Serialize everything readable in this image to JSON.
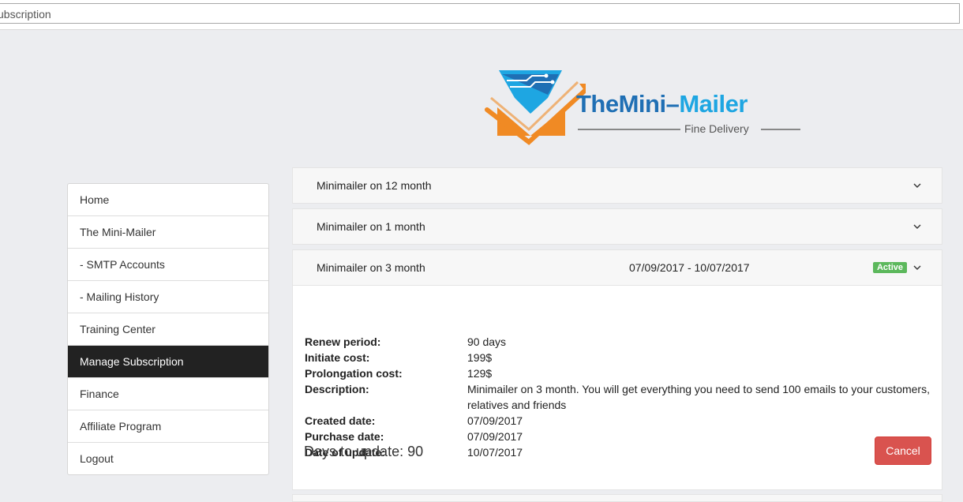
{
  "browser": {
    "address": "ubscription"
  },
  "logo": {
    "part1": "TheMini",
    "dash": "–",
    "part2": "Mailer",
    "tagline": "Fine Delivery"
  },
  "sidebar": {
    "items": [
      {
        "label": "Home"
      },
      {
        "label": "The Mini-Mailer"
      },
      {
        "label": "- SMTP Accounts"
      },
      {
        "label": "- Mailing History"
      },
      {
        "label": "Training Center"
      },
      {
        "label": "Manage Subscription",
        "active": true
      },
      {
        "label": "Finance"
      },
      {
        "label": "Affiliate Program"
      },
      {
        "label": "Logout"
      }
    ]
  },
  "subscriptions": [
    {
      "title": "Minimailer on 12 month"
    },
    {
      "title": "Minimailer on 1 month"
    },
    {
      "title": "Minimailer on 3 month",
      "dates": "07/09/2017 - 10/07/2017",
      "status": "Active",
      "details": {
        "renew_label": "Renew period:",
        "renew": "90 days",
        "initiate_label": "Initiate cost:",
        "initiate": "199$",
        "prolong_label": "Prolongation cost:",
        "prolong": "129$",
        "desc_label": "Description:",
        "desc": "Minimailer on 3 month. You will get everything you need to send 100 emails to your customers, relatives and friends",
        "created_label": "Created date:",
        "created": "07/09/2017",
        "purchase_label": "Purchase date:",
        "purchase": "07/09/2017",
        "update_label": "Date of update:",
        "update": "10/07/2017"
      },
      "days_to_update": "Days to update: 90",
      "cancel_label": "Cancel"
    }
  ],
  "colors": {
    "active_nav": "#222222",
    "badge": "#5cb85c",
    "cancel": "#d9534f",
    "logo_dark_blue": "#1f6fb4",
    "logo_light_blue": "#1ea6e2",
    "logo_orange": "#f08a24"
  }
}
